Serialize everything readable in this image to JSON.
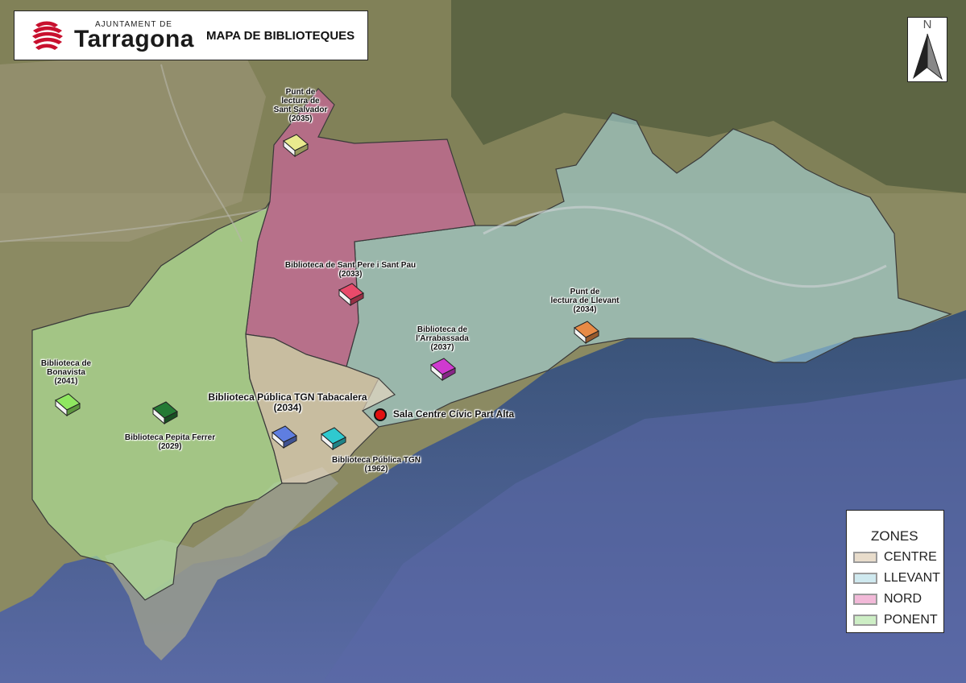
{
  "header": {
    "logo_small": "AJUNTAMENT DE",
    "logo_big": "Tarragona",
    "title": "MAPA DE BIBLIOTEQUES"
  },
  "north_label": "N",
  "legend": {
    "title": "ZONES",
    "items": [
      {
        "label": "CENTRE",
        "color": "#e8dccb"
      },
      {
        "label": "LLEVANT",
        "color": "#cfe9ef"
      },
      {
        "label": "NORD",
        "color": "#f2b9d8"
      },
      {
        "label": "PONENT",
        "color": "#cdeec5"
      }
    ]
  },
  "libraries": [
    {
      "line1": "Punt de",
      "line2": "lectura de",
      "line3": "Sant Salvador",
      "year": "(2035)",
      "color": "#e9ea8e"
    },
    {
      "line1": "Biblioteca de Sant Pere i Sant Pau",
      "year": "(2033)",
      "color": "#e84a6a"
    },
    {
      "line1": "Biblioteca de",
      "line2": "l'Arrabassada",
      "year": "(2037)",
      "color": "#cf3ad0"
    },
    {
      "line1": "Punt de",
      "line2": "lectura de Llevant",
      "year": "(2034)",
      "color": "#e88a45"
    },
    {
      "line1": "Biblioteca de",
      "line2": "Bonavista",
      "year": "(2041)",
      "color": "#8fe760"
    },
    {
      "line1": "Biblioteca Pepita Ferrer",
      "year": "(2029)",
      "color": "#247a35"
    },
    {
      "line1": "Biblioteca Pública TGN Tabacalera",
      "year": "(2034)",
      "color": "#5f7ee0"
    },
    {
      "line1": "Biblioteca Pública TGN",
      "year": "(1962)",
      "color": "#2fc9cf"
    }
  ],
  "center_point": {
    "label": "Sala Centre Cívic Part Alta",
    "color": "#e01010"
  }
}
